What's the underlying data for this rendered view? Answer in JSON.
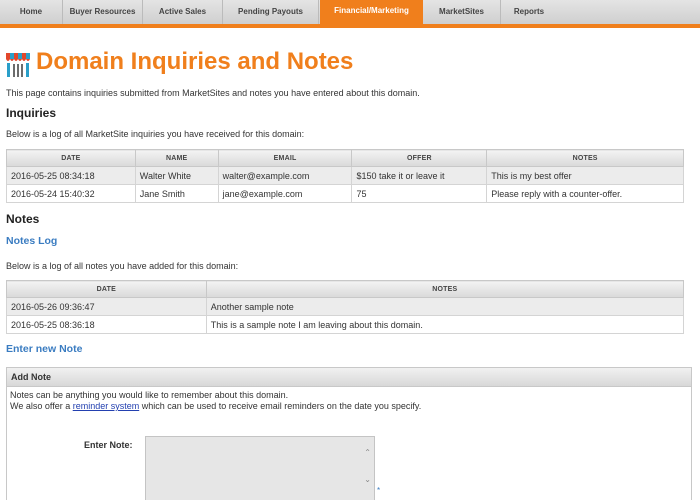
{
  "nav": {
    "items": [
      {
        "label": "Home"
      },
      {
        "label": "Buyer Resources"
      },
      {
        "label": "Active Sales"
      },
      {
        "label": "Pending Payouts"
      },
      {
        "label": "Financial/Marketing",
        "active": true
      },
      {
        "label": "MarketSites"
      },
      {
        "label": "Reports"
      }
    ],
    "accent_color": "#f07f1c"
  },
  "page": {
    "icon": "storefront-icon",
    "title": "Domain Inquiries and Notes",
    "intro": "This page contains inquiries submitted from MarketSites and notes you have entered about this domain."
  },
  "inquiries": {
    "heading": "Inquiries",
    "description": "Below is a log of all MarketSite inquiries you have received for this domain:",
    "columns": [
      "DATE",
      "NAME",
      "EMAIL",
      "OFFER",
      "NOTES"
    ],
    "rows": [
      [
        "2016-05-25 08:34:18",
        "Walter White",
        "walter@example.com",
        "$150 take it or leave it",
        "This is my best offer"
      ],
      [
        "2016-05-24 15:40:32",
        "Jane Smith",
        "jane@example.com",
        "75",
        "Please reply with a counter-offer."
      ]
    ]
  },
  "notes": {
    "heading": "Notes",
    "log_heading": "Notes Log",
    "description": "Below is a log of all notes you have added for this domain:",
    "columns": [
      "DATE",
      "NOTES"
    ],
    "rows": [
      [
        "2016-05-26 09:36:47",
        "Another sample note"
      ],
      [
        "2016-05-25 08:36:18",
        "This is a sample note I am leaving about this domain."
      ]
    ],
    "new_heading": "Enter new Note"
  },
  "add_note": {
    "header": "Add Note",
    "line1": "Notes can be anything you would like to remember about this domain.",
    "line2_pre": "We also offer a ",
    "line2_link": "reminder system",
    "line2_post": " which can be used to receive email reminders on the date you specify.",
    "field_label": "Enter Note:",
    "field_value": "",
    "required_mark": "*"
  }
}
